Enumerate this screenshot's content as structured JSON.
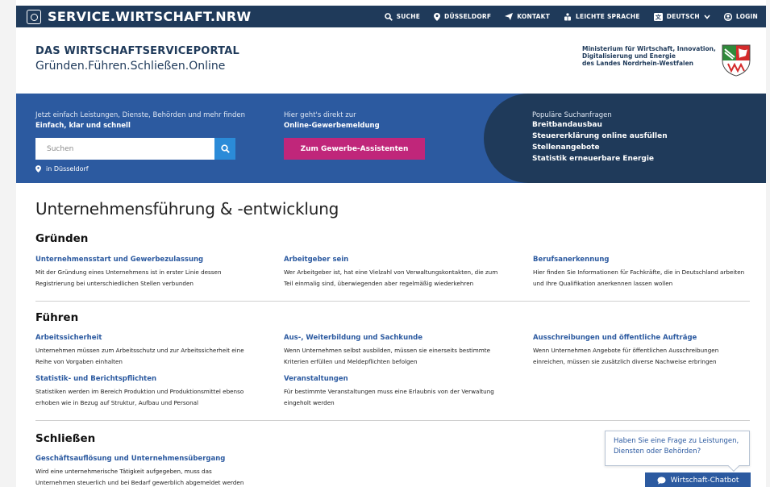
{
  "topbar": {
    "brand": "SERVICE.WIRTSCHAFT.NRW",
    "nav": [
      {
        "label": "SUCHE",
        "icon": "search-icon"
      },
      {
        "label": "DÜSSELDORF",
        "icon": "location-pin-icon"
      },
      {
        "label": "KONTAKT",
        "icon": "send-icon"
      },
      {
        "label": "LEICHTE SPRACHE",
        "icon": "easy-language-icon"
      },
      {
        "label": "DEUTSCH",
        "icon": "language-icon"
      },
      {
        "label": "LOGIN",
        "icon": "user-icon"
      }
    ]
  },
  "header": {
    "title": "DAS WIRTSCHAFTSERVICEPORTAL",
    "subtitle": "Gründen.Führen.Schließen.Online",
    "ministry_lines": [
      "Ministerium für Wirtschaft, Innovation,",
      "Digitalisierung und Energie",
      "des Landes Nordrhein-Westfalen"
    ]
  },
  "hero": {
    "search_intro": "Jetzt einfach Leistungen, Dienste, Behörden und mehr finden",
    "search_strong": "Einfach, klar und schnell",
    "search_placeholder": "Suchen",
    "location": "in Düsseldorf",
    "gewerbe_intro": "Hier geht's direkt zur",
    "gewerbe_strong": "Online-Gewerbemeldung",
    "gewerbe_button": "Zum Gewerbe-Assistenten",
    "popular_label": "Populäre Suchanfragen",
    "popular_items": [
      "Breitbandausbau",
      "Steuererklärung online ausfüllen",
      "Stellenangebote",
      "Statistik erneuerbare Energie"
    ]
  },
  "main": {
    "page_title": "Unternehmensführung & -entwicklung",
    "sections": [
      {
        "title": "Gründen",
        "cards": [
          {
            "link": "Unternehmensstart und Gewerbezulassung",
            "desc": "Mit der Gründung eines Unternehmens ist in erster Linie dessen Registrierung bei unterschiedlichen Stellen verbunden"
          },
          {
            "link": "Arbeitgeber sein",
            "desc": "Wer Arbeitgeber ist, hat eine Vielzahl von Verwaltungskontakten, die zum Teil einmalig sind, überwiegenden aber regelmäßig wiederkehren"
          },
          {
            "link": "Berufsanerkennung",
            "desc": "Hier finden Sie Informationen für Fachkräfte, die in Deutschland arbeiten und Ihre Qualifikation anerkennen lassen wollen"
          }
        ]
      },
      {
        "title": "Führen",
        "cards": [
          {
            "link": "Arbeitssicherheit",
            "desc": "Unternehmen müssen zum Arbeitsschutz und zur Arbeitssicherheit eine Reihe von Vorgaben einhalten"
          },
          {
            "link": "Aus-, Weiterbildung und Sachkunde",
            "desc": "Wenn Unternehmen selbst ausbilden, müssen sie einerseits bestimmte Kriterien erfüllen und Meldepflichten befolgen"
          },
          {
            "link": "Ausschreibungen und öffentliche Aufträge",
            "desc": "Wenn Unternehmen Angebote für öffentlichen Ausschreibungen einreichen, müssen sie zusätzlich diverse Nachweise erbringen"
          },
          {
            "link": "Statistik- und Berichtspflichten",
            "desc": "Statistiken werden im Bereich Produktion und Produktionsmittel ebenso erhoben wie in Bezug auf Struktur, Aufbau und Personal"
          },
          {
            "link": "Veranstaltungen",
            "desc": "Für bestimmte Veranstaltungen muss eine Erlaubnis von der Verwaltung eingeholt werden"
          }
        ]
      },
      {
        "title": "Schließen",
        "cards": [
          {
            "link": "Geschäftsauflösung und Unternehmensübergang",
            "desc": "Wird eine unternehmerische Tätigkeit aufgegeben, muss das Unternehmen steuerlich und bei Bedarf gewerblich abgemeldet werden"
          }
        ]
      }
    ]
  },
  "chatbot": {
    "bubble": "Haben Sie eine Frage zu Leistungen, Diensten oder Behörden?",
    "button": "Wirtschaft-Chatbot"
  },
  "colors": {
    "navy": "#1f3a5a",
    "hero_blue": "#2c5aa0",
    "magenta": "#c0267a",
    "link_blue": "#2c5aa0"
  }
}
